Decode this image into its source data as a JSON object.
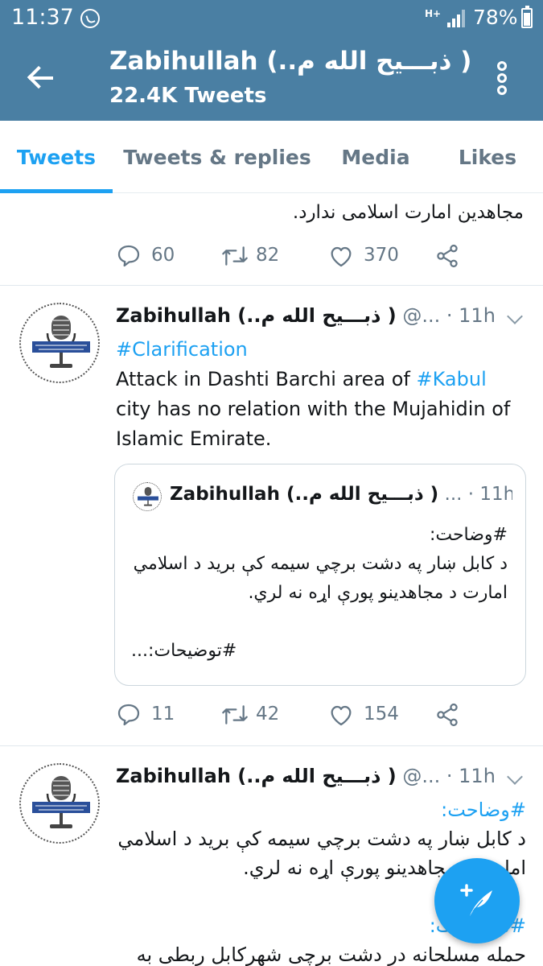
{
  "status_bar": {
    "time": "11:37",
    "network": "H+",
    "battery": "78%"
  },
  "app_bar": {
    "title": "Zabihullah (..ذبـــيح الله م )",
    "subtitle": "22.4K Tweets"
  },
  "tabs": [
    {
      "label": "Tweets",
      "active": true
    },
    {
      "label": "Tweets & replies",
      "active": false
    },
    {
      "label": "Media",
      "active": false
    },
    {
      "label": "Likes",
      "active": false
    }
  ],
  "feed": {
    "partial_tweet": {
      "text": "مجاهدین امارت اسلامی ندارد.",
      "replies": "60",
      "retweets": "82",
      "likes": "370"
    },
    "tweets": [
      {
        "name": "Zabihullah (..ذبـــيح الله م )",
        "handle": "@...",
        "time": "11h",
        "hashtag": "#Clarification",
        "text_1": "Attack in Dashti Barchi area of ",
        "hashtag_2": "#Kabul",
        "text_2": " city has no relation with the Mujahidin of Islamic Emirate.",
        "quote": {
          "name": "Zabihullah (..ذبـــيح الله م )",
          "handle": "...",
          "time": "11h",
          "hashtag": "#وضاحت:",
          "text": "د کابل ښار په دشت برچي سيمه کې برید د اسلامي امارت د مجاهدینو پورې اړه نه لري.",
          "footer": "#توضیحات:..."
        },
        "replies": "11",
        "retweets": "42",
        "likes": "154"
      },
      {
        "name": "Zabihullah (..ذبـــيح الله م )",
        "handle": "@...",
        "time": "11h",
        "hashtag": "#وضاحت:",
        "text": "د کابل ښار په دشت برچي سيمه کې برید د اسلامي امارت د مجاهدینو پورې اړه نه لري.",
        "hashtag_2": "#توضیحات:",
        "text_2": "حمله مسلحانه در دشت برچی شهرکابل ربطی به"
      }
    ]
  },
  "colors": {
    "header_bg": "#4a7fa3",
    "accent": "#1da1f2",
    "secondary_text": "#657786"
  }
}
